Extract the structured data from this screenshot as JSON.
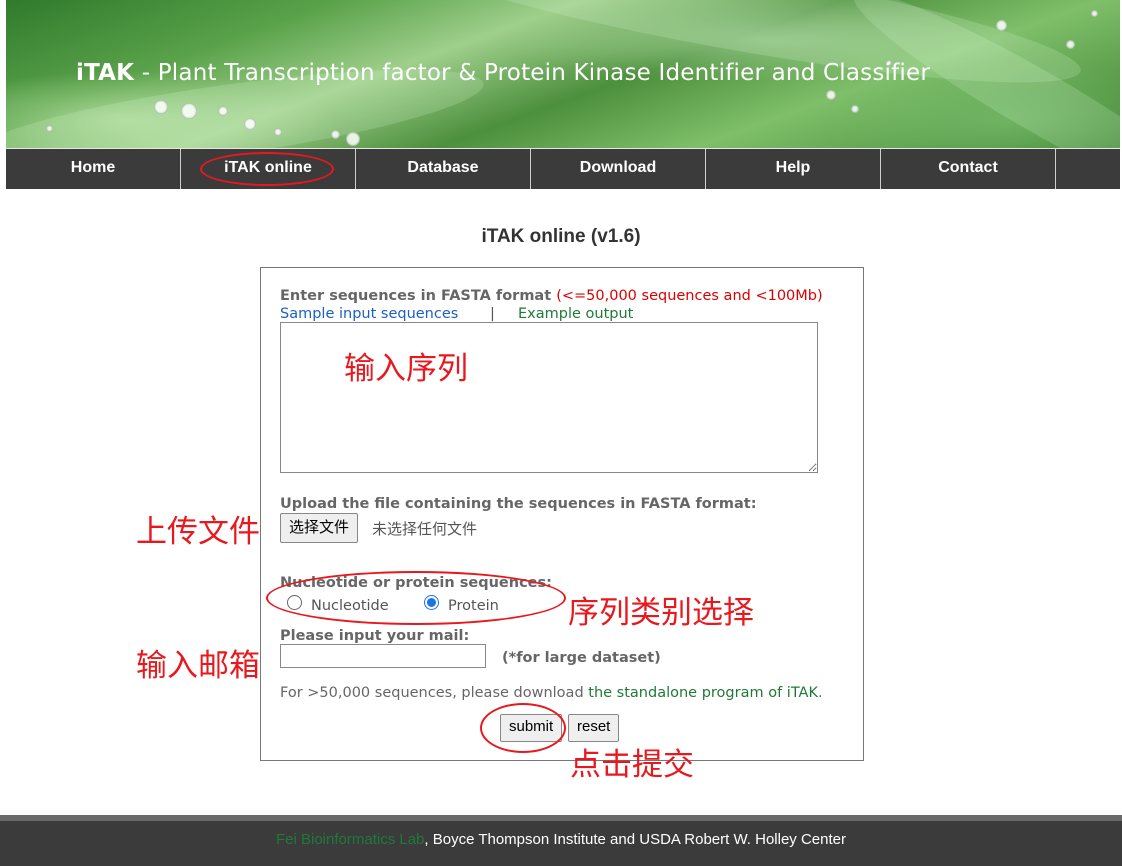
{
  "header": {
    "brand": "iTAK",
    "title": " - Plant Transcription factor & Protein Kinase Identifier and Classifier"
  },
  "nav": {
    "items": [
      "Home",
      "iTAK online",
      "Database",
      "Download",
      "Help",
      "Contact"
    ]
  },
  "main": {
    "page_title": "iTAK online (v1.6)",
    "seq_label": "Enter sequences in FASTA format",
    "seq_limit": "(<=50,000 sequences and <100Mb)",
    "sample_link": "Sample input sequences",
    "separator": "|",
    "example_link": "Example output",
    "seq_value": "",
    "upload_label": "Upload the file containing the sequences in FASTA format:",
    "file_button": "选择文件",
    "file_status": "未选择任何文件",
    "type_label": "Nucleotide or protein sequences:",
    "type_options": [
      "Nucleotide",
      "Protein"
    ],
    "type_selected": "Protein",
    "mail_label": "Please input your mail:",
    "mail_value": "",
    "mail_note": "(*for large dataset)",
    "large_note": "For >50,000 sequences, please download ",
    "standalone_link": "the standalone program of iTAK",
    "large_note_end": ".",
    "submit": "submit",
    "reset": "reset"
  },
  "annotations": {
    "input_sequence": "输入序列",
    "upload_file": "上传文件",
    "sequence_type": "序列类别选择",
    "input_email": "输入邮箱",
    "click_submit": "点击提交"
  },
  "footer": {
    "lab": "Fei Bioinformatics Lab",
    "rest": ", Boyce Thompson Institute and USDA Robert W. Holley Center"
  },
  "colors": {
    "nav_bg": "#3b3b3b",
    "annotation_red": "#e8191e",
    "link_blue": "#1a5fc4",
    "link_green": "#1f7a38",
    "limit_red": "#d00000"
  }
}
